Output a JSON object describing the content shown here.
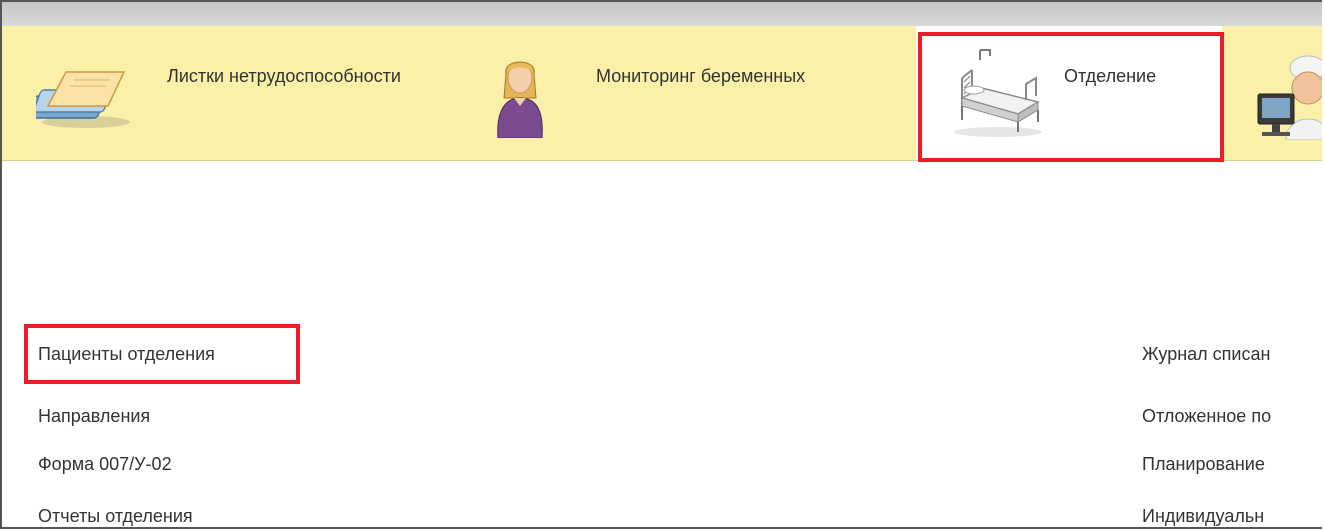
{
  "sections": [
    {
      "label": "Листки нетрудоспособности",
      "icon": "sick-leave-documents-icon",
      "active": false
    },
    {
      "label": "Мониторинг беременных",
      "icon": "pregnant-woman-icon",
      "active": false
    },
    {
      "label": "Отделение",
      "icon": "hospital-bed-icon",
      "active": true
    },
    {
      "label": "",
      "icon": "doctor-at-computer-icon",
      "active": false
    }
  ],
  "main": {
    "left_links": [
      "Пациенты отделения",
      "Направления",
      "Форма 007/У-02",
      "Отчеты отделения"
    ],
    "right_links": [
      "Журнал списан",
      "Отложенное по",
      "Планирование",
      "Индивидуальн"
    ]
  },
  "colors": {
    "section_bar": "#faf0a8",
    "highlight": "#ee1c25"
  }
}
